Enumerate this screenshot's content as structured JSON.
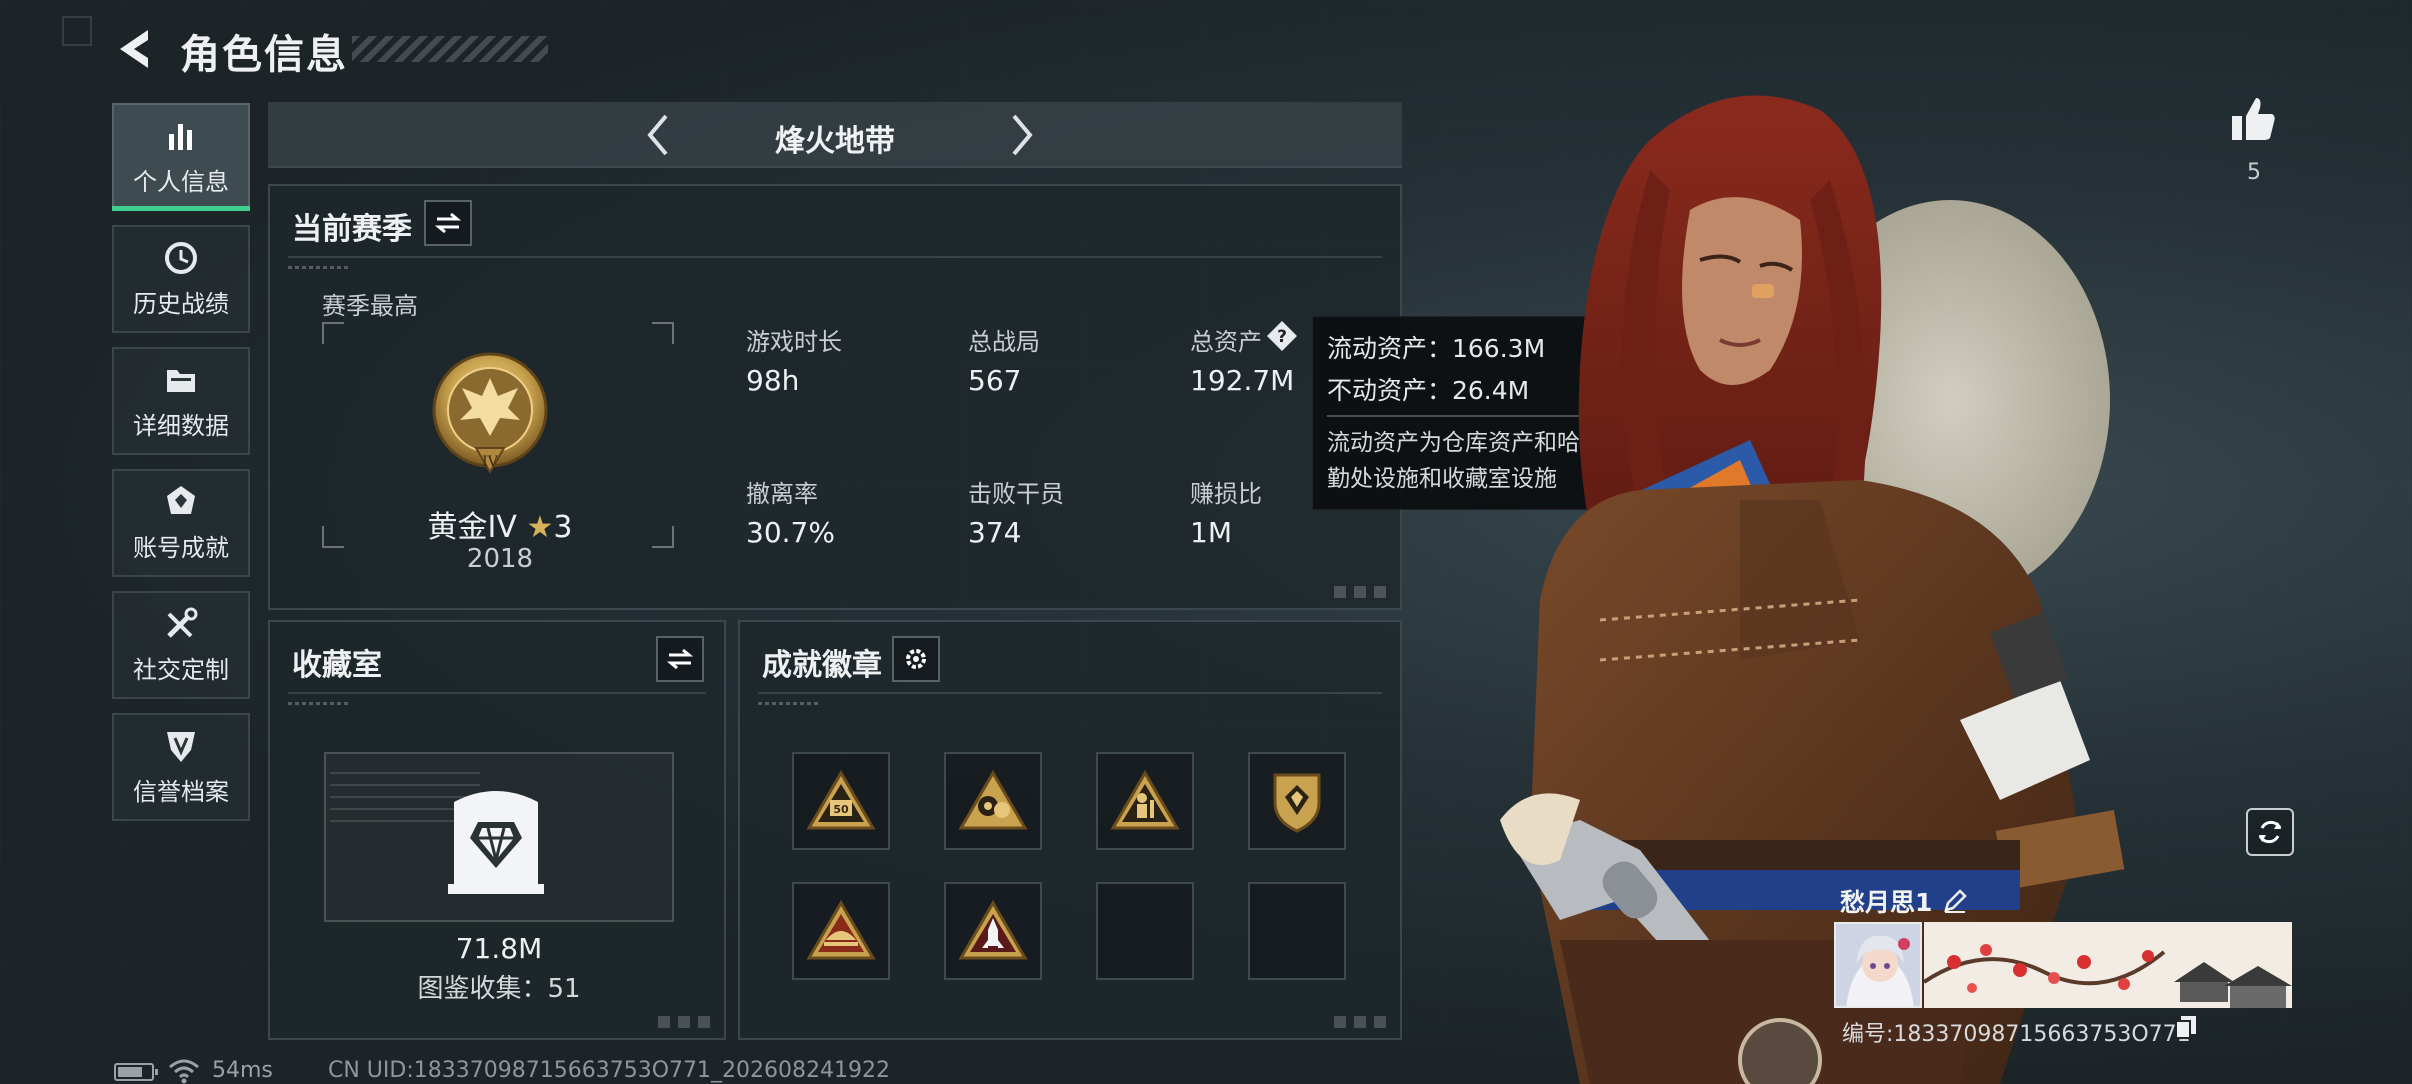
{
  "header": {
    "title": "角色信息",
    "back_icon": "back-arrow-icon"
  },
  "sidebar": {
    "items": [
      {
        "label": "个人信息",
        "icon": "bar-chart-icon",
        "active": true
      },
      {
        "label": "历史战绩",
        "icon": "history-clock-icon",
        "active": false
      },
      {
        "label": "详细数据",
        "icon": "folder-icon",
        "active": false
      },
      {
        "label": "账号成就",
        "icon": "achievement-icon",
        "active": false
      },
      {
        "label": "社交定制",
        "icon": "tools-icon",
        "active": false
      },
      {
        "label": "信誉档案",
        "icon": "shield-badge-icon",
        "active": false
      }
    ]
  },
  "mode": {
    "label": "烽火地带"
  },
  "season": {
    "title": "当前赛季",
    "best_label": "赛季最高",
    "rank_name": "黄金IV",
    "rank_stars": "3",
    "rank_score": "2018",
    "stats": [
      {
        "label": "游戏时长",
        "value": "98h"
      },
      {
        "label": "总战局",
        "value": "567"
      },
      {
        "label": "总资产",
        "value": "192.7M"
      },
      {
        "label": "撤离率",
        "value": "30.7%"
      },
      {
        "label": "击败干员",
        "value": "374"
      },
      {
        "label": "赚损比",
        "value": "1M"
      }
    ]
  },
  "tooltip": {
    "liquid": "流动资产：166.3M",
    "fixed": "不动资产：26.4M",
    "desc": "流动资产为仓库资产和哈夫币，不动资产为特勤处设施和收藏室设施"
  },
  "vault": {
    "title": "收藏室",
    "value": "71.8M",
    "collection": "图鉴收集：51"
  },
  "badges": {
    "title": "成就徽章",
    "slots": [
      "badge-50-triangle",
      "badge-gear-triangle",
      "badge-soldier-triangle",
      "badge-shield-gem",
      "badge-ship-triangle",
      "badge-rocket-triangle",
      "empty",
      "empty"
    ]
  },
  "likes": {
    "count": "5"
  },
  "player": {
    "name": "愁月思1",
    "id": "编号:18337098715663753O771"
  },
  "footer": {
    "ping": "54ms",
    "uid": "CN UID:18337098715663753O771_202608241922"
  },
  "colors": {
    "accent_green": "#3fcf8e",
    "gold": "#c8a24e",
    "panel_border": "#3b474d"
  }
}
